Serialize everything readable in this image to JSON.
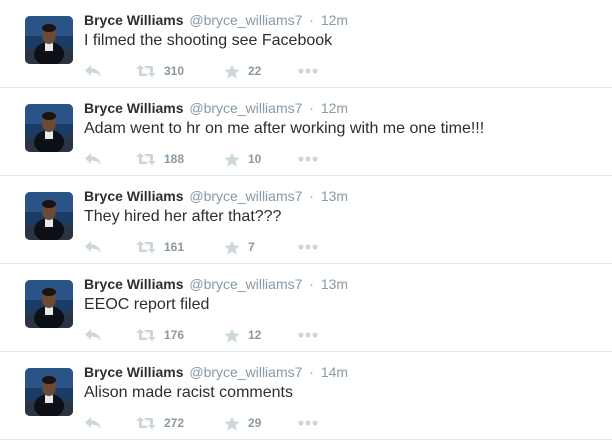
{
  "tweets": [
    {
      "fullname": "Bryce Williams",
      "username": "@bryce_williams7",
      "separator": "·",
      "time": "12m",
      "text": "I filmed the shooting see Facebook",
      "retweets": "310",
      "favorites": "22"
    },
    {
      "fullname": "Bryce Williams",
      "username": "@bryce_williams7",
      "separator": "·",
      "time": "12m",
      "text": "Adam went to hr on me after working with me one time!!!",
      "retweets": "188",
      "favorites": "10"
    },
    {
      "fullname": "Bryce Williams",
      "username": "@bryce_williams7",
      "separator": "·",
      "time": "13m",
      "text": "They hired her after that???",
      "retweets": "161",
      "favorites": "7"
    },
    {
      "fullname": "Bryce Williams",
      "username": "@bryce_williams7",
      "separator": "·",
      "time": "13m",
      "text": "EEOC report filed",
      "retweets": "176",
      "favorites": "12"
    },
    {
      "fullname": "Bryce Williams",
      "username": "@bryce_williams7",
      "separator": "·",
      "time": "14m",
      "text": "Alison made racist comments",
      "retweets": "272",
      "favorites": "29"
    }
  ],
  "icons": {
    "reply": "reply-icon",
    "retweet": "retweet-icon",
    "favorite": "star-icon",
    "more": "more-dots-icon"
  },
  "colors": {
    "name": "#292f33",
    "meta": "#8899a6",
    "icon": "#ccd6dd",
    "divider": "#e1e8ed"
  }
}
